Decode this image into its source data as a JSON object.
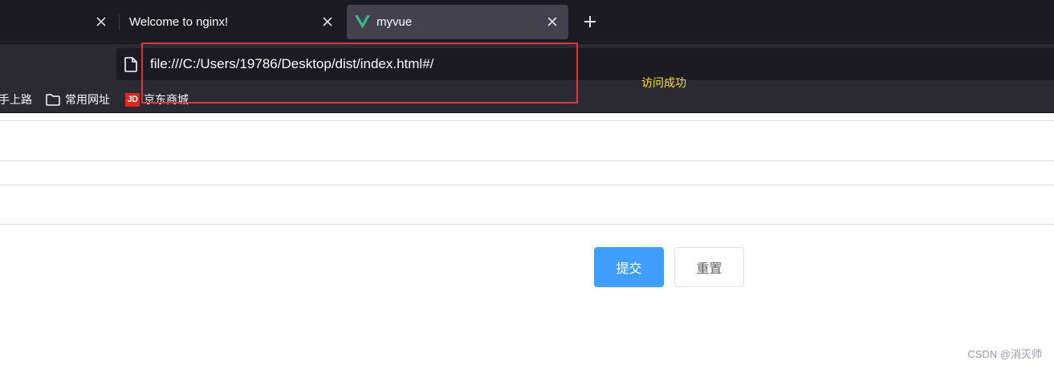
{
  "tabs": [
    {
      "title": ""
    },
    {
      "title": "Welcome to nginx!"
    },
    {
      "title": "myvue",
      "active": true,
      "icon": "vue-logo-icon"
    }
  ],
  "address_bar": {
    "url": "file:///C:/Users/19786/Desktop/dist/index.html#/"
  },
  "bookmarks": [
    {
      "label": "手上路"
    },
    {
      "label": "常用网址",
      "icon": "folder-icon"
    },
    {
      "label": "京东商城",
      "icon": "jd-logo-icon",
      "icon_text": "JD"
    }
  ],
  "annotation": {
    "text": "访问成功",
    "color": "#f7e01e",
    "box_color": "#e3343c"
  },
  "form": {
    "submit_label": "提交",
    "reset_label": "重置"
  },
  "watermark": "CSDN @消灭师",
  "colors": {
    "tab_strip": "#1c1b22",
    "toolbar": "#2b2a33",
    "active_tab": "#42414d",
    "primary": "#409eff",
    "vue_green": "#41b883"
  }
}
